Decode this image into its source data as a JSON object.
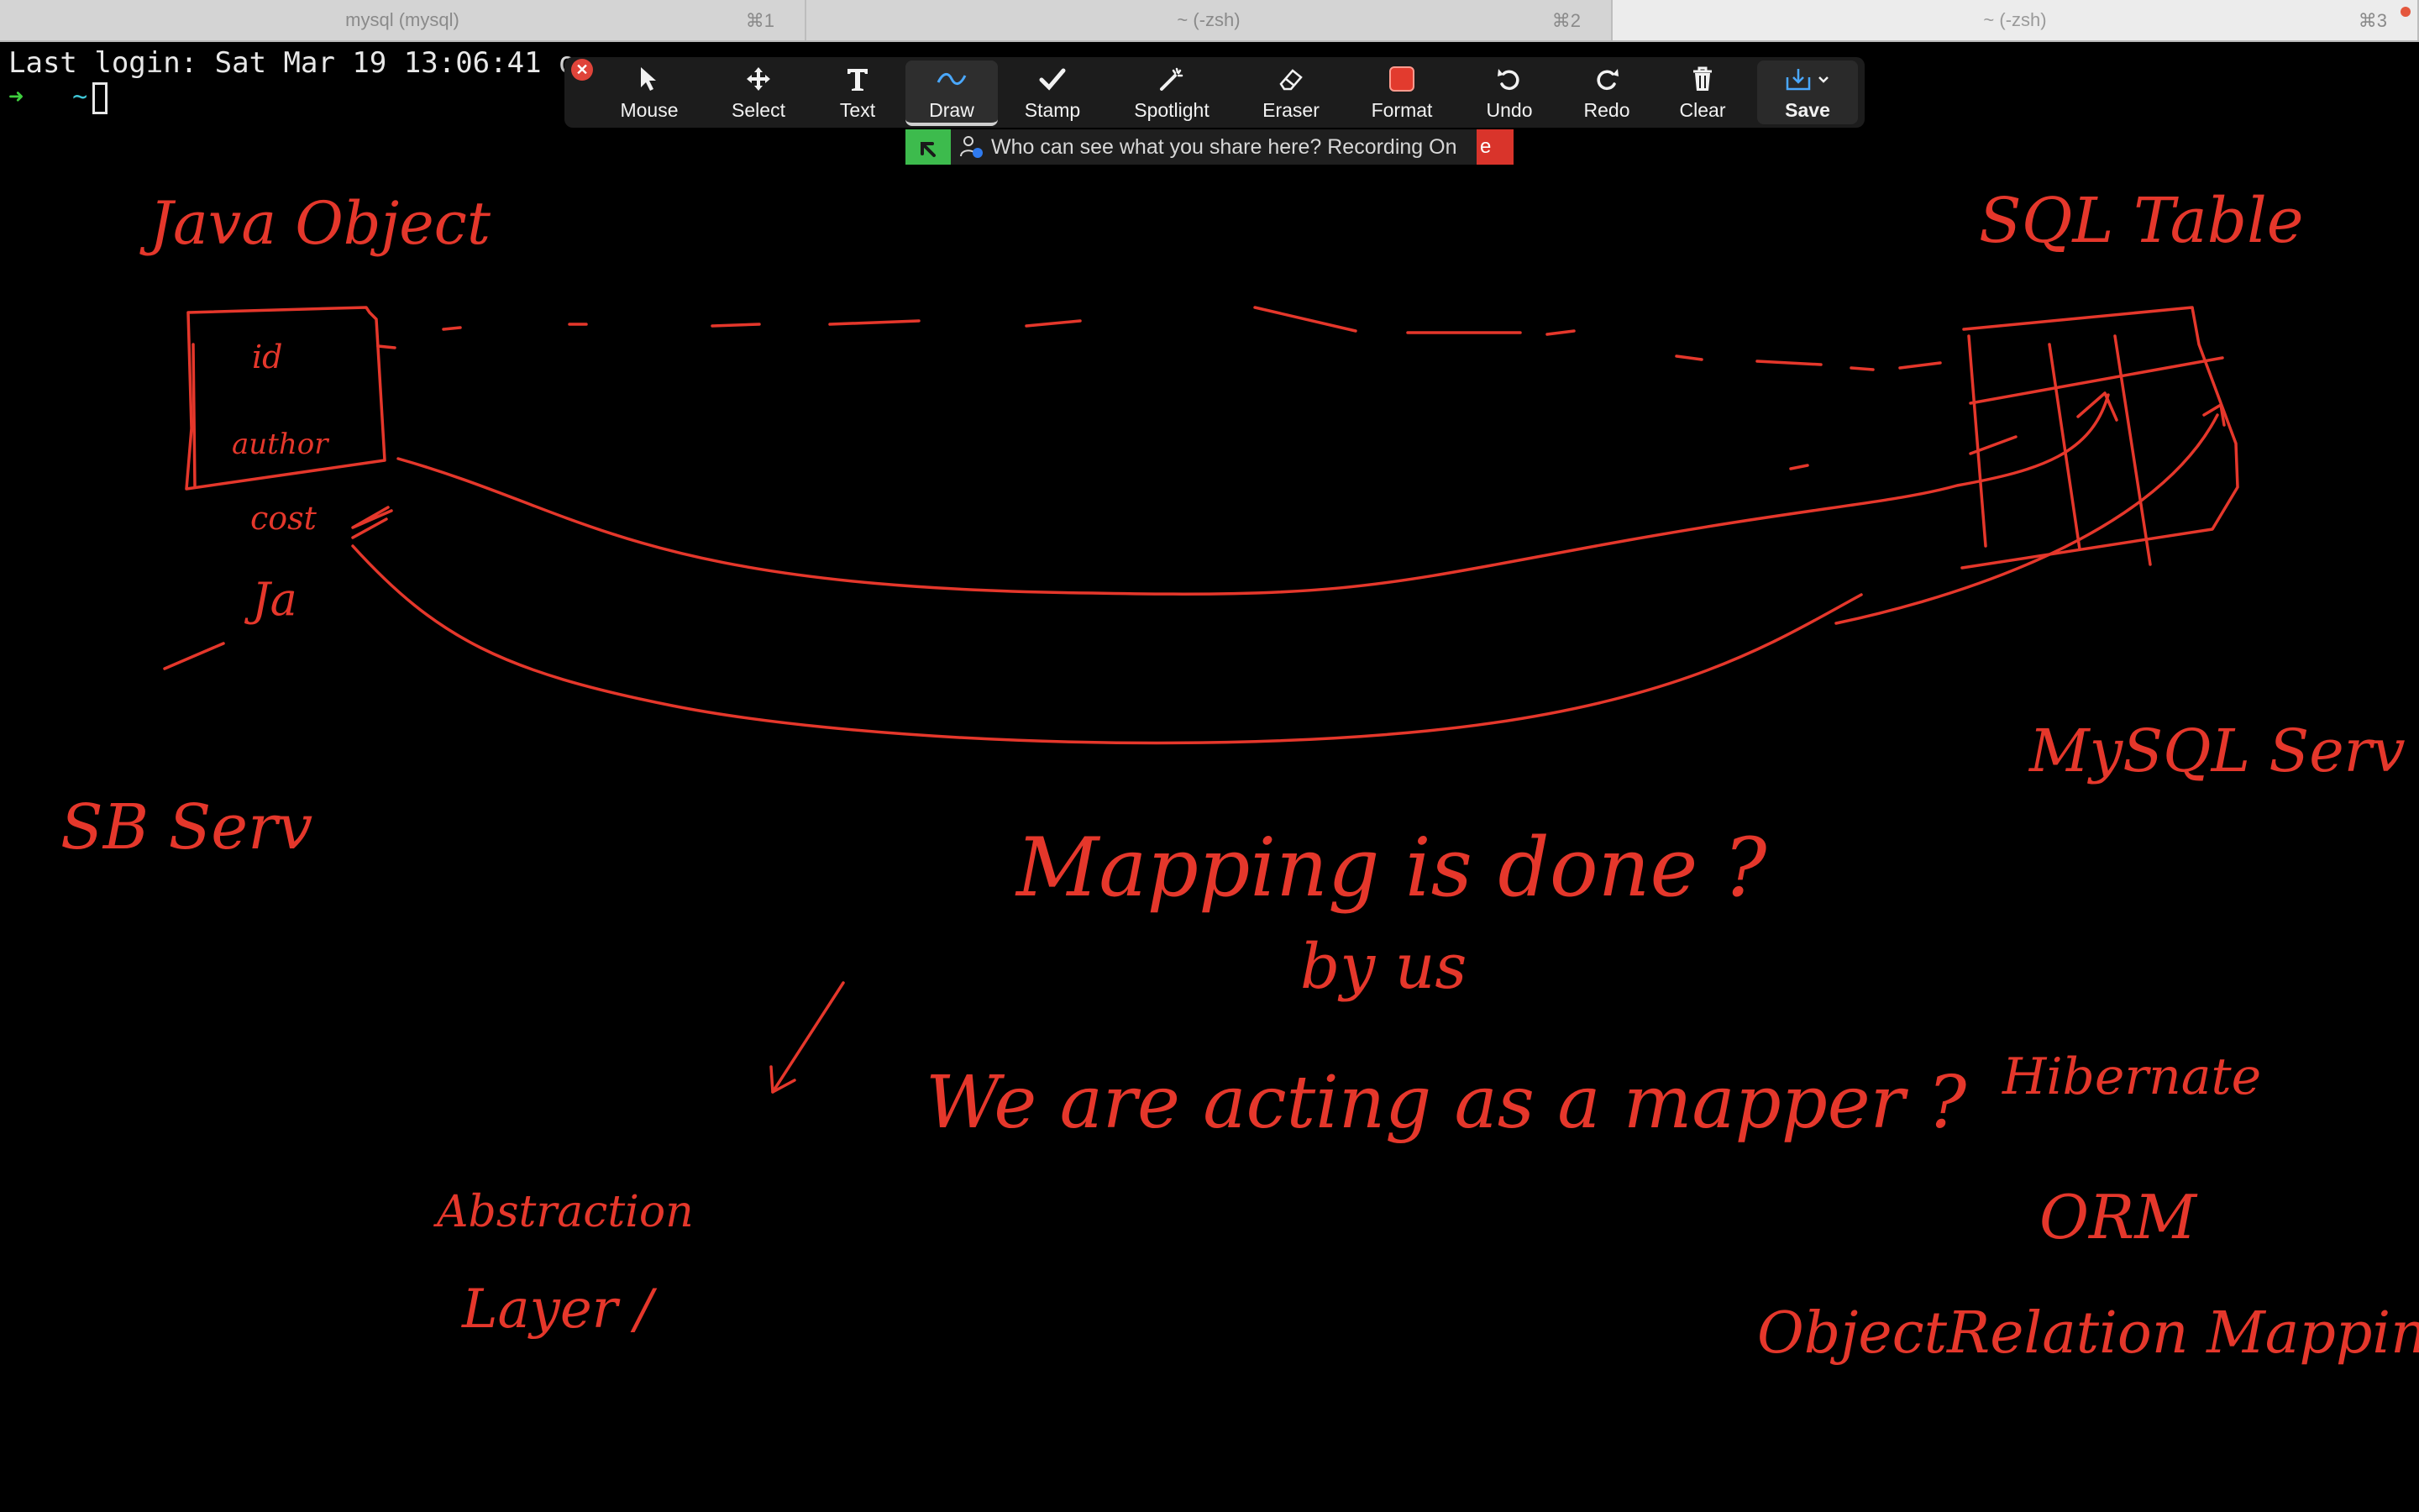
{
  "tabs": [
    {
      "title": "mysql (mysql)",
      "shortcut": "⌘1"
    },
    {
      "title": "~ (-zsh)",
      "shortcut": "⌘2"
    },
    {
      "title": "~ (-zsh)",
      "shortcut": "⌘3"
    }
  ],
  "terminal": {
    "last_login": "Last login: Sat Mar 19 13:06:41 o",
    "prompt_arrow": "➜",
    "prompt_dir": "~"
  },
  "toolbar": {
    "tools": [
      {
        "label": "Mouse",
        "icon": "cursor-arrow-icon"
      },
      {
        "label": "Select",
        "icon": "move-arrows-icon"
      },
      {
        "label": "Text",
        "icon": "text-t-icon"
      },
      {
        "label": "Draw",
        "icon": "squiggle-icon"
      },
      {
        "label": "Stamp",
        "icon": "checkmark-icon"
      },
      {
        "label": "Spotlight",
        "icon": "magic-wand-icon"
      },
      {
        "label": "Eraser",
        "icon": "eraser-icon"
      },
      {
        "label": "Format",
        "icon": "color-swatch-icon"
      },
      {
        "label": "Undo",
        "icon": "undo-icon"
      },
      {
        "label": "Redo",
        "icon": "redo-icon"
      },
      {
        "label": "Clear",
        "icon": "trash-icon"
      },
      {
        "label": "Save",
        "icon": "download-tray-icon"
      }
    ],
    "active_tool": "Draw",
    "format_color": "#e23b2e"
  },
  "share_banner": {
    "text": "Who can see what you share here? Recording On",
    "end_letter": "e"
  },
  "whiteboard": {
    "ink_color": "#e5372b",
    "notes": {
      "java_object": "Java Object",
      "sql_table": "SQL Table",
      "box_id": "id",
      "box_author": "author",
      "cost": "cost",
      "ja": "Ja",
      "sb_server": "SB Serv",
      "mysql_server": "MySQL Serv",
      "mapping_q": "Mapping is done ?",
      "by_us": "by us",
      "we_are": "We are acting as a mapper ?",
      "abstraction": "Abstraction",
      "layer": "Layer /",
      "hibernate": "Hibernate",
      "orm": "ORM",
      "object_relation": "ObjectRelation Mapping"
    }
  }
}
